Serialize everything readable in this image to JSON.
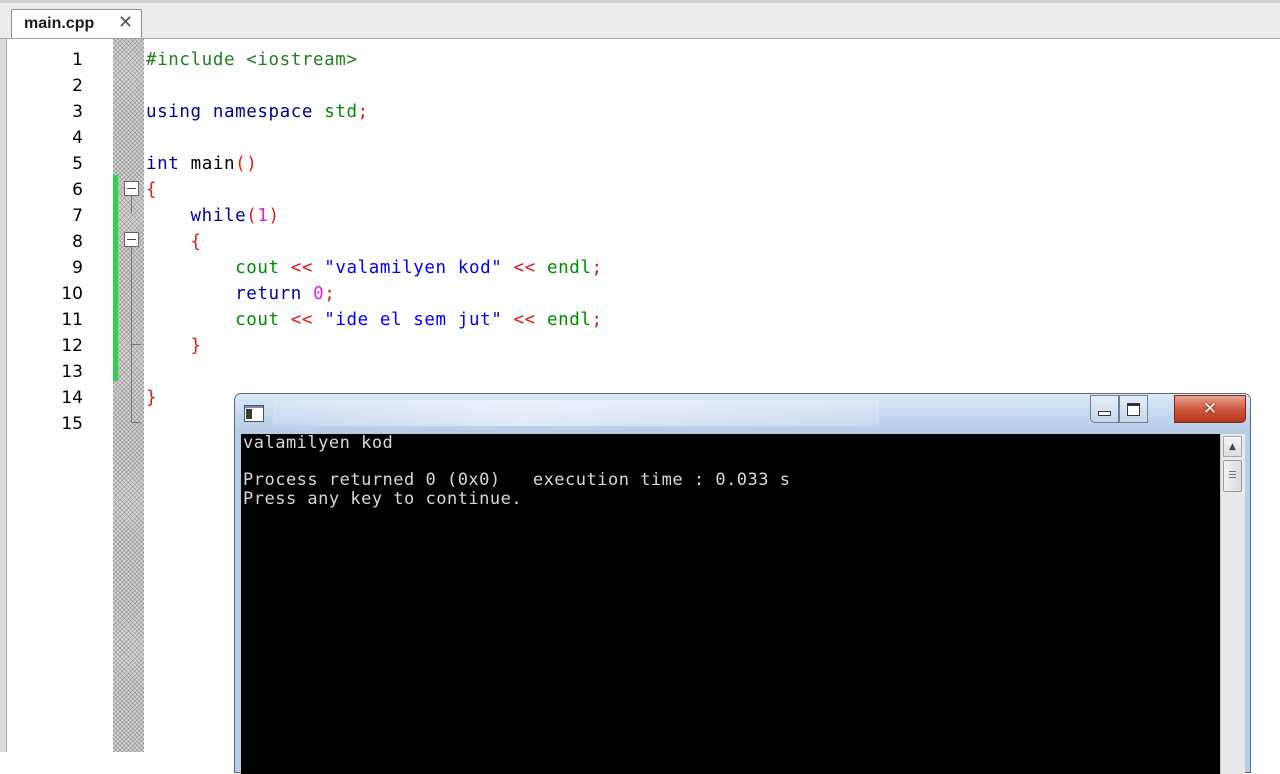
{
  "tab": {
    "title": "main.cpp",
    "close_glyph": "✕"
  },
  "editor": {
    "line_numbers": [
      "1",
      "2",
      "3",
      "4",
      "5",
      "6",
      "7",
      "8",
      "9",
      "10",
      "11",
      "12",
      "13",
      "14",
      "15"
    ],
    "code": {
      "l1": {
        "directive": "#include <iostream>"
      },
      "l3": {
        "kw1": "using",
        "kw2": "namespace",
        "id": "std",
        "semi": ";"
      },
      "l5": {
        "kw": "int",
        "name": "main",
        "parens": "()"
      },
      "l6": {
        "brace": "{"
      },
      "l7": {
        "kw": "while",
        "open": "(",
        "num": "1",
        "close": ")"
      },
      "l8": {
        "brace": "{"
      },
      "l9": {
        "id1": "cout",
        "op1": "<<",
        "str": "\"valamilyen kod\"",
        "op2": "<<",
        "id2": "endl",
        "semi": ";"
      },
      "l10": {
        "kw": "return",
        "num": "0",
        "semi": ";"
      },
      "l11": {
        "id1": "cout",
        "op1": "<<",
        "str": "\"ide el sem jut\"",
        "op2": "<<",
        "id2": "endl",
        "semi": ";"
      },
      "l12": {
        "brace": "}"
      },
      "l14": {
        "brace": "}"
      }
    },
    "change_bar_color": "#2fd24a"
  },
  "console": {
    "title_icon": "console-app-icon",
    "buttons": {
      "minimize": "minimize",
      "maximize": "maximize",
      "close_glyph": "✕"
    },
    "output": {
      "line1": "valamilyen kod",
      "line2": "",
      "line3": "Process returned 0 (0x0)   execution time : 0.033 s",
      "line4": "Press any key to continue."
    },
    "scroll_up_glyph": "▲"
  }
}
